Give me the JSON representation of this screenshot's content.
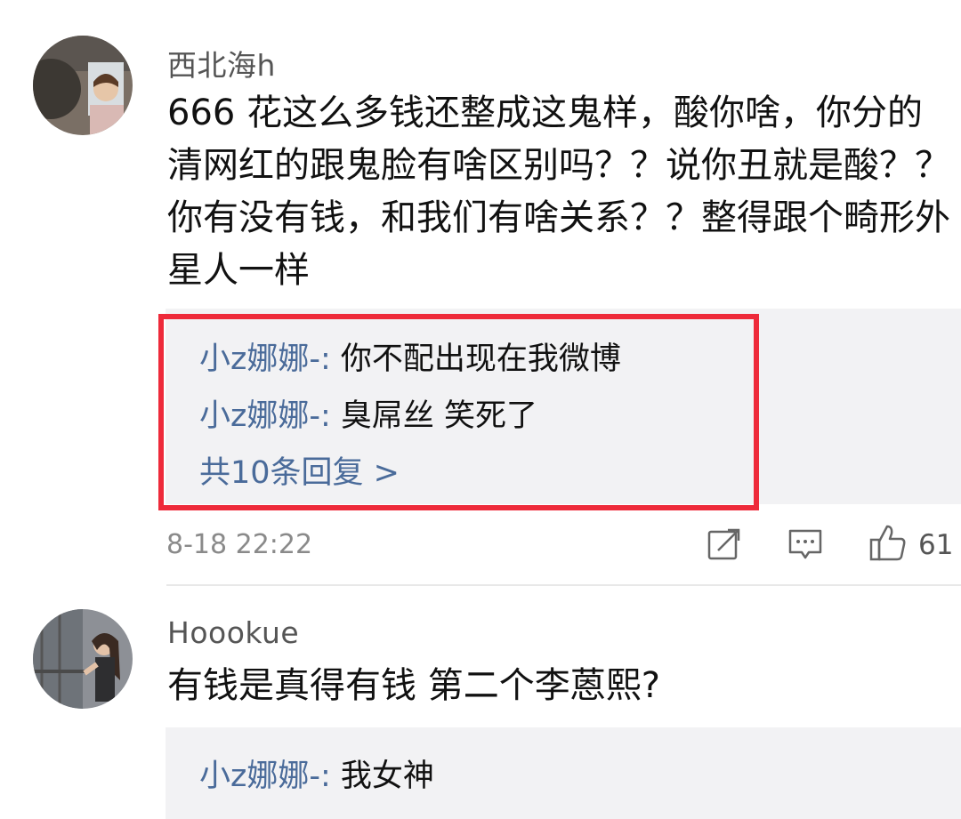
{
  "comments": [
    {
      "username": "西北海h",
      "text": "666 花这么多钱还整成这鬼样，酸你啥，你分的\n清网红的跟鬼脸有啥区别吗？？说你丑就是酸？？\n你有没有钱，和我们有啥关系？？整得跟个畸形外\n星人一样",
      "replies": [
        {
          "user": "小z娜娜-:",
          "text": " 你不配出现在我微博"
        },
        {
          "user": "小z娜娜-:",
          "text": " 臭屌丝 笑死了"
        }
      ],
      "more_replies": "共10条回复 >",
      "timestamp": "8-18 22:22",
      "like_count": "61",
      "icons": [
        "share-icon",
        "comment-icon",
        "like-icon"
      ]
    },
    {
      "username": "Hoookue",
      "text": "有钱是真得有钱 第二个李蒽熙?",
      "replies": [
        {
          "user": "小z娜娜-:",
          "text": " 我女神"
        }
      ]
    }
  ],
  "colors": {
    "highlight_border": "#ee2a3a",
    "reply_background": "#f2f2f4",
    "reply_username": "#4a6b9a"
  }
}
